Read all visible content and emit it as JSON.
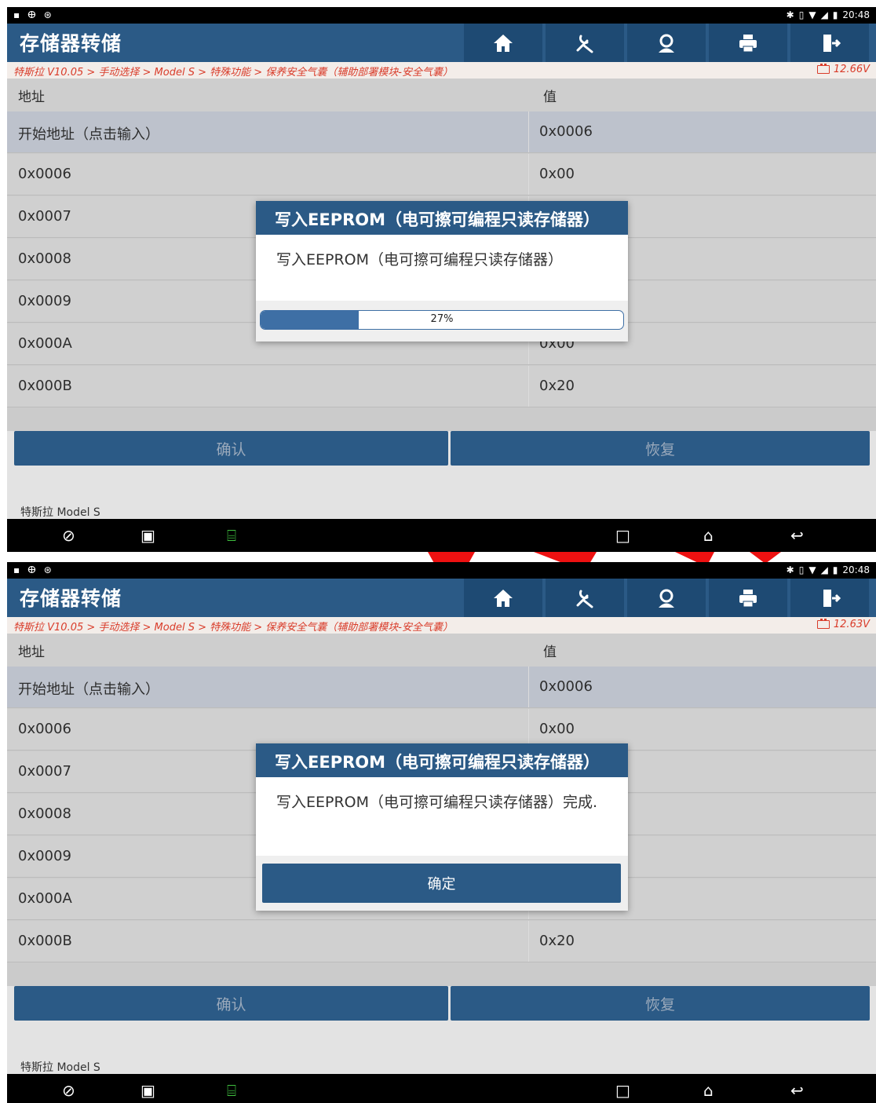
{
  "screens": [
    {
      "status": {
        "time": "20:48"
      },
      "title": "存储器转储",
      "breadcrumb": "特斯拉 V10.05 > 手动选择 > Model S > 特殊功能 > 保养安全气囊（辅助部署模块-安全气囊）",
      "voltage": "12.66V",
      "table": {
        "headers": [
          "地址",
          "值"
        ],
        "rows": [
          {
            "address": "开始地址（点击输入）",
            "value": "0x0006"
          },
          {
            "address": "0x0006",
            "value": "0x00"
          },
          {
            "address": "0x0007",
            "value": ""
          },
          {
            "address": "0x0008",
            "value": ""
          },
          {
            "address": "0x0009",
            "value": ""
          },
          {
            "address": "0x000A",
            "value": "0x00"
          },
          {
            "address": "0x000B",
            "value": "0x20"
          }
        ]
      },
      "buttons": {
        "confirm": "确认",
        "restore": "恢复"
      },
      "car_label": "特斯拉 Model S",
      "dialog": {
        "title": "写入EEPROM（电可擦可编程只读存储器）",
        "message": "写入EEPROM（电可擦可编程只读存储器）",
        "progress_label": "27%",
        "progress_fraction": 0.27
      }
    },
    {
      "status": {
        "time": "20:48"
      },
      "title": "存储器转储",
      "breadcrumb": "特斯拉 V10.05 > 手动选择 > Model S > 特殊功能 > 保养安全气囊（辅助部署模块-安全气囊）",
      "voltage": "12.63V",
      "table": {
        "headers": [
          "地址",
          "值"
        ],
        "rows": [
          {
            "address": "开始地址（点击输入）",
            "value": "0x0006"
          },
          {
            "address": "0x0006",
            "value": "0x00"
          },
          {
            "address": "0x0007",
            "value": ""
          },
          {
            "address": "0x0008",
            "value": ""
          },
          {
            "address": "0x0009",
            "value": ""
          },
          {
            "address": "0x000A",
            "value": ""
          },
          {
            "address": "0x000B",
            "value": "0x20"
          }
        ]
      },
      "buttons": {
        "confirm": "确认",
        "restore": "恢复"
      },
      "car_label": "特斯拉 Model S",
      "dialog": {
        "title": "写入EEPROM（电可擦可编程只读存储器）",
        "message": "写入EEPROM（电可擦可编程只读存储器）完成.",
        "ok_label": "确定"
      }
    }
  ],
  "icons": {
    "toolbar": [
      "home-icon",
      "repair-tools-icon",
      "support-agent-icon",
      "print-icon",
      "exit-icon"
    ],
    "navbar": [
      "browser-icon",
      "gallery-icon",
      "vci-icon",
      "recent-apps-icon",
      "home-nav-icon",
      "back-icon"
    ]
  },
  "colors": {
    "header_blue": "#2b5a86",
    "breadcrumb_red": "#d93c2a",
    "progress_blue": "#3e6fa5",
    "watermark_red": "#ee1111"
  }
}
